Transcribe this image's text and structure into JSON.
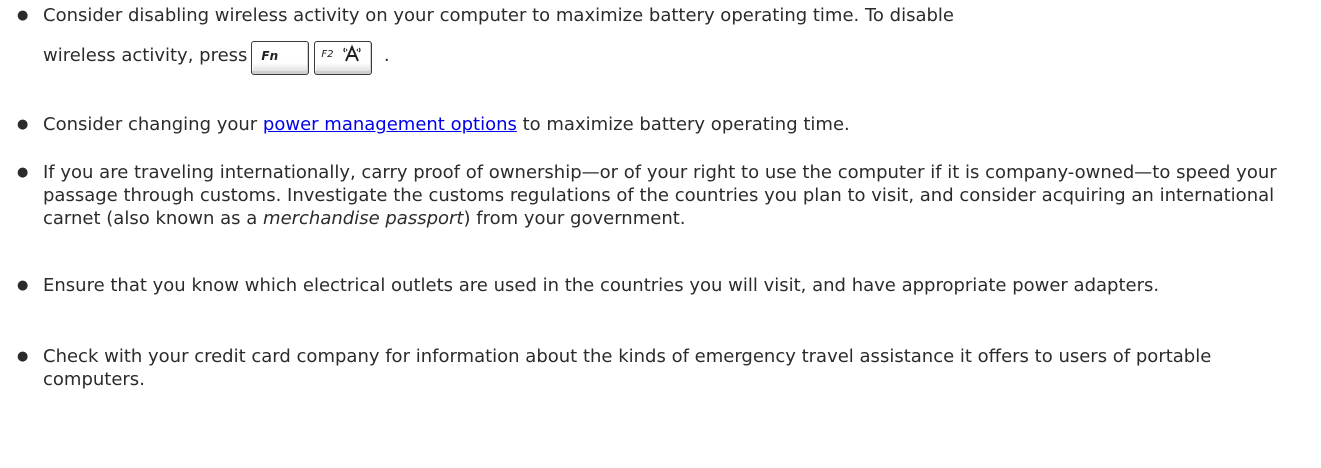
{
  "items": [
    {
      "text_before": "Consider disabling wireless activity on your computer to maximize battery operating time. To disable",
      "text_line2": "wireless activity, press",
      "key_fn": "Fn",
      "key_f2": "F2",
      "key_icon": "wireless-antenna-icon",
      "text_after": "."
    },
    {
      "text_before": "Consider changing your ",
      "link": "power management options",
      "text_after": " to maximize battery operating time."
    },
    {
      "text_before": "If you are traveling internationally, carry proof of ownership—or of your right to use the computer if it is company-owned—to speed your passage through customs. Investigate the customs regulations of the countries you plan to visit, and consider acquiring an international carnet (also known as a ",
      "emphasis": "merchandise passport",
      "text_after": ") from your government."
    },
    {
      "text": "Ensure that you know which electrical outlets are used in the countries you will visit, and have appropriate power adapters."
    },
    {
      "text": "Check with your credit card company for information about the kinds of emergency travel assistance it offers to users of portable computers."
    }
  ]
}
